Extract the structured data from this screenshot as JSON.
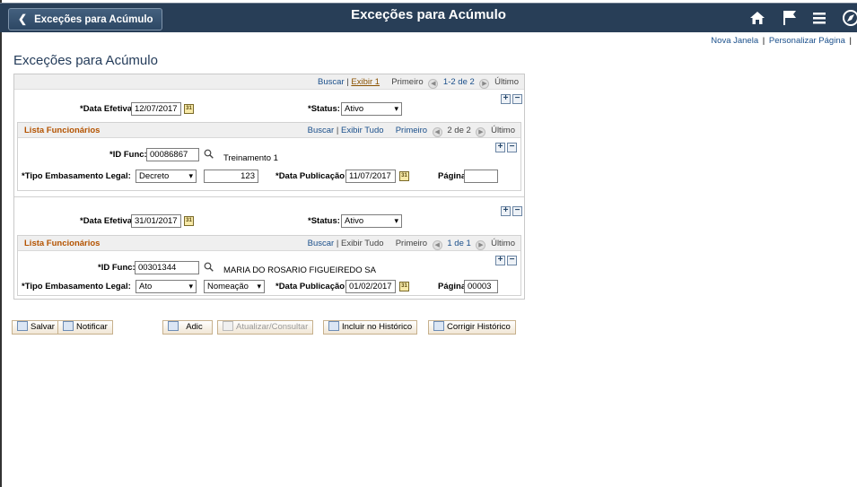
{
  "header": {
    "back_label": "Exceções para Acúmulo",
    "title": "Exceções para Acúmulo",
    "icons": [
      "home-icon",
      "flag-icon",
      "menu-icon",
      "compass-icon"
    ]
  },
  "links": {
    "new_window": "Nova Janela",
    "personalize": "Personalizar Página",
    "sep": "|"
  },
  "page_title": "Exceções para Acúmulo",
  "outer_nav": {
    "buscar": "Buscar",
    "sep": "|",
    "exibir": "Exibir 1",
    "primeiro": "Primeiro",
    "range": "1-2 de 2",
    "ultimo": "Último"
  },
  "records": [
    {
      "date_label": "*Data Efetiva:",
      "date_value": "12/07/2017",
      "status_label": "*Status:",
      "status_value": "Ativo",
      "list": {
        "title": "Lista Funcionários",
        "buscar": "Buscar",
        "sep": "|",
        "exibir": "Exibir Tudo",
        "primeiro": "Primeiro",
        "range": "2 de 2",
        "ultimo": "Último"
      },
      "id_label": "*ID Func:",
      "id_value": "00086867",
      "name": "Treinamento 1",
      "tipo_label": "*Tipo Embasamento Legal:",
      "tipo_value": "Decreto",
      "tipo_extra_value": "123",
      "pub_label": "*Data Publicação:",
      "pub_value": "11/07/2017",
      "pagina_label": "Página:",
      "pagina_value": ""
    },
    {
      "date_label": "*Data Efetiva:",
      "date_value": "31/01/2017",
      "status_label": "*Status:",
      "status_value": "Ativo",
      "list": {
        "title": "Lista Funcionários",
        "buscar": "Buscar",
        "sep": "|",
        "exibir": "Exibir Tudo",
        "primeiro": "Primeiro",
        "range": "1 de 1",
        "ultimo": "Último"
      },
      "id_label": "*ID Func:",
      "id_value": "00301344",
      "name": "MARIA DO ROSARIO FIGUEIREDO SA",
      "tipo_label": "*Tipo Embasamento Legal:",
      "tipo_value": "Ato",
      "tipo_extra_value": "Nomeação",
      "pub_label": "*Data Publicação:",
      "pub_value": "01/02/2017",
      "pagina_label": "Página:",
      "pagina_value": "00003"
    }
  ],
  "toolbar": {
    "salvar": "Salvar",
    "notificar": "Notificar",
    "adic": "Adic",
    "atualizar": "Atualizar/Consultar",
    "incluir": "Incluir no Histórico",
    "corrigir": "Corrigir Histórico"
  },
  "icon_glyphs": {
    "add": "+",
    "remove": "−",
    "cal": "31",
    "search": "🔍",
    "prev": "◀",
    "next": "▶",
    "dropdown": "▾"
  }
}
